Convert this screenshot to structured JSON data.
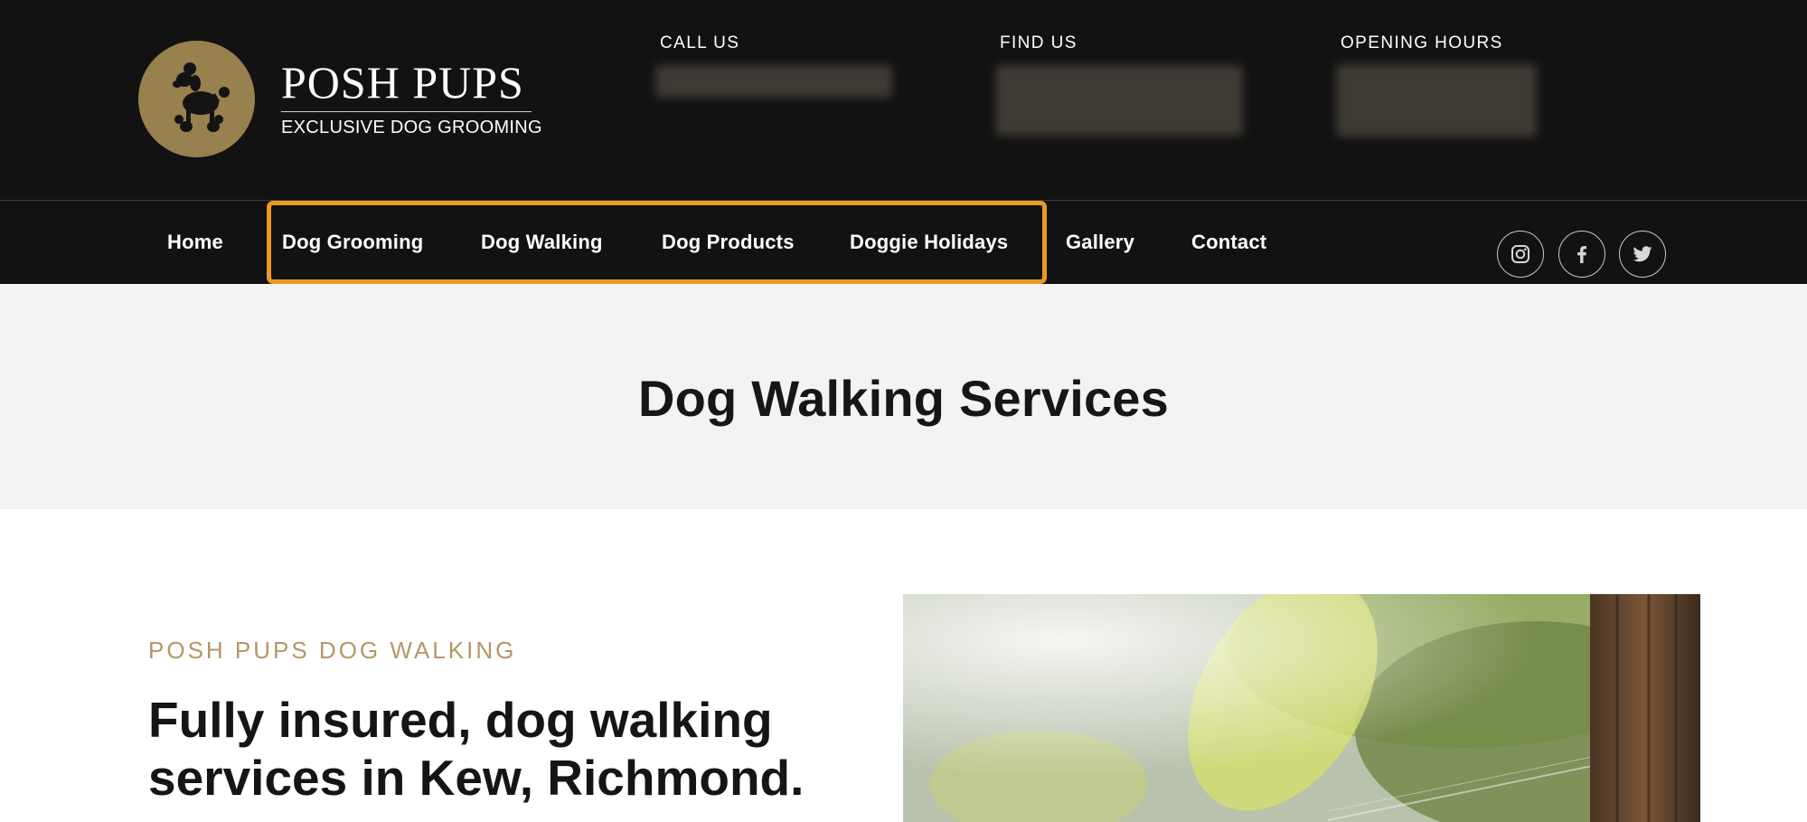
{
  "brand": {
    "name": "POSH PUPS",
    "tagline": "EXCLUSIVE DOG GROOMING",
    "badge_color": "#98804f"
  },
  "header": {
    "call": {
      "label": "CALL US"
    },
    "find": {
      "label": "FIND US"
    },
    "hours": {
      "label": "OPENING HOURS"
    }
  },
  "nav": {
    "items": [
      {
        "label": "Home"
      },
      {
        "label": "Dog Grooming"
      },
      {
        "label": "Dog Walking"
      },
      {
        "label": "Dog Products"
      },
      {
        "label": "Doggie Holidays"
      },
      {
        "label": "Gallery"
      },
      {
        "label": "Contact"
      }
    ],
    "highlight_color": "#ec9a22",
    "social": [
      {
        "icon": "instagram-icon"
      },
      {
        "icon": "facebook-icon"
      },
      {
        "icon": "twitter-icon"
      }
    ]
  },
  "page": {
    "title": "Dog Walking Services"
  },
  "content": {
    "eyebrow": "POSH PUPS DOG WALKING",
    "headline": "Fully insured, dog walking services in Kew, Richmond."
  },
  "colors": {
    "header_bg": "#121212",
    "accent_gold": "#b39766",
    "title_band_bg": "#f2f3f2"
  }
}
